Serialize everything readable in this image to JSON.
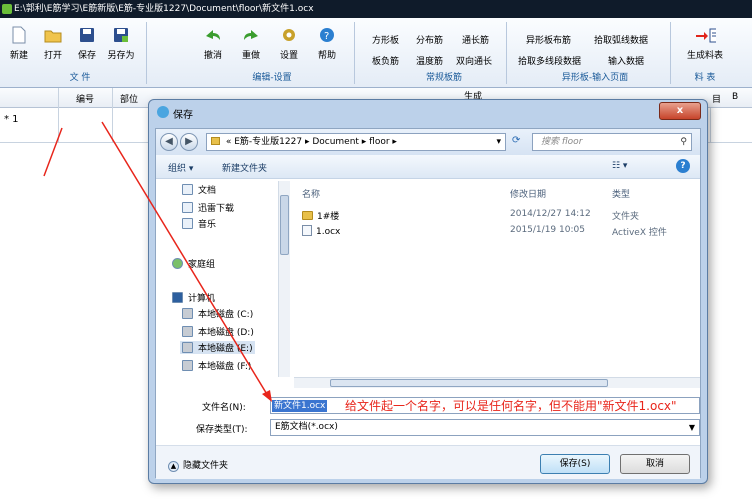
{
  "window": {
    "title": "E:\\郭利\\E筋学习\\E筋新版\\E筋-专业版1227\\Document\\floor\\新文件1.ocx"
  },
  "ribbon": {
    "file_buttons": [
      {
        "label": "新建",
        "icon": "new-file-icon"
      },
      {
        "label": "打开",
        "icon": "open-folder-icon"
      },
      {
        "label": "保存",
        "icon": "save-icon"
      },
      {
        "label": "另存为",
        "icon": "save-as-icon"
      }
    ],
    "file_group": "文 件",
    "edit_buttons": [
      {
        "label": "撤消",
        "icon": "undo-icon"
      },
      {
        "label": "重做",
        "icon": "redo-icon"
      },
      {
        "label": "设置",
        "icon": "settings-icon"
      },
      {
        "label": "帮助",
        "icon": "help-icon"
      }
    ],
    "edit_group": "编辑-设置",
    "slab_items": [
      "方形板",
      "分布筋",
      "通长筋",
      "板负筋",
      "温度筋",
      "双向通长"
    ],
    "slab_group": "常规板筋",
    "special_items": [
      "异形板布筋",
      "拾取弧线数据",
      "拾取多线段数据",
      "输入数据"
    ],
    "special_group": "异形板-输入页面",
    "table_button": "生成料表",
    "table_group": "料 表"
  },
  "sheet": {
    "columns": [
      "编号",
      "部位"
    ],
    "row_marker": "* 1",
    "partial_labels": [
      "生成",
      "目",
      "B"
    ]
  },
  "dialog": {
    "title": "保存",
    "close_label": "x",
    "address_path": "« E筋-专业版1227 ▸ Document ▸ floor ▸",
    "search_placeholder": "搜索 floor",
    "organize_label": "组织 ▾",
    "new_folder_label": "新建文件夹",
    "nav_items": [
      "文档",
      "迅雷下载",
      "音乐",
      "家庭组",
      "计算机",
      "本地磁盘 (C:)",
      "本地磁盘 (D:)",
      "本地磁盘 (E:)",
      "本地磁盘 (F:)"
    ],
    "file_columns": [
      "名称",
      "修改日期",
      "类型"
    ],
    "files": [
      {
        "name": "1#楼",
        "date": "2014/12/27 14:12",
        "type": "文件夹",
        "icon": "folder-icon"
      },
      {
        "name": "1.ocx",
        "date": "2015/1/19 10:05",
        "type": "ActiveX 控件",
        "icon": "file-icon"
      }
    ],
    "filename_label": "文件名(N):",
    "filename_value": "新文件1.ocx",
    "filetype_label": "保存类型(T):",
    "filetype_value": "E筋文档(*.ocx)",
    "hide_folders": "隐藏文件夹",
    "save_button": "保存(S)",
    "cancel_button": "取消"
  },
  "annotation": {
    "text": "给文件起一个名字，可以是任何名字，但不能用\"新文件1.ocx\"",
    "color": "#e8251b"
  },
  "colors": {
    "accent_blue": "#1a5a99",
    "title_bg": "#0f1b2a",
    "selection": "#3a75d0"
  }
}
